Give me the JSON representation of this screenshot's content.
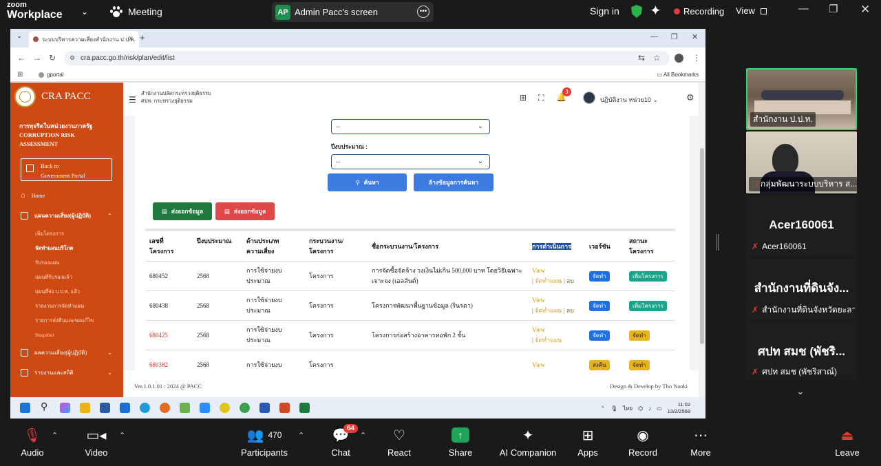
{
  "zoom": {
    "logo_line1": "zoom",
    "logo_line2": "Workplace",
    "meeting_label": "Meeting",
    "share_badge": "AP",
    "share_label": "Admin Pacc's screen",
    "signin": "Sign in",
    "recording": "Recording",
    "view": "View",
    "bottom": {
      "audio": "Audio",
      "video": "Video",
      "participants": "Participants",
      "participants_count": "470",
      "chat": "Chat",
      "chat_badge": "64",
      "react": "React",
      "share": "Share",
      "ai_companion": "AI Companion",
      "apps": "Apps",
      "record": "Record",
      "more": "More",
      "leave": "Leave"
    },
    "participants_panel": [
      {
        "type": "video",
        "name": "สำนักงาน ป.ป.ท.",
        "muted": false
      },
      {
        "type": "video",
        "name": "กลุ่มพัฒนาระบบบริหาร ส...",
        "muted": true
      },
      {
        "type": "text",
        "big": "Acer160061",
        "name": "Acer160061"
      },
      {
        "type": "text",
        "big": "สำนักงานที่ดินจัง...",
        "name": "สำนักงานที่ดินจังหวัดยะลา"
      },
      {
        "type": "text",
        "big": "ศปท สมช (พัชริ...",
        "name": "ศปท สมช (พัชริสาณ์)"
      }
    ]
  },
  "browser": {
    "tab_title": "ระบบบริหารความเสี่ยงสำนักงาน ป.ป.ท.",
    "url": "cra.pacc.go.th/risk/plan/edit/list",
    "bookmark": "gportal",
    "all_bookmarks": "All Bookmarks"
  },
  "sidebar": {
    "brand": "CRA PACC",
    "subtitle_1": "การทุจริตในหน่วยงานภาครัฐ",
    "subtitle_2": "CORRUPTION RISK",
    "subtitle_3": "ASSESSMENT",
    "back_1": "Back to",
    "back_2": "Government Portal",
    "home": "Home",
    "menu_plan": "แผนความเสี่ยง(ผู้ปฏิบัติ)",
    "sub_items": [
      "เพิ่มโครงการ",
      "จัดทำแผนบริโภค",
      "รับรองแผน",
      "แผนที่รับรองแล้ว",
      "แผนที่ส่ง ป.ป.ท. แล้ว",
      "รายงานการจัดทำแผน",
      "รายการส่งคืนและขอแก้ไข",
      "Snapshot"
    ],
    "menu_result": "ผลความเสี่ยง(ผู้ปฏิบัติ)",
    "menu_report": "รายงานและสถิติ"
  },
  "header": {
    "org_1": "สำนักงานปลัดกระทรวงยุติธรรม",
    "org_2": "ศปท. กระทรวงยุติธรรม",
    "notif_count": "3",
    "user": "ปฏิบัติงาน หน่วย10"
  },
  "filters": {
    "select1_value": "--",
    "fiscal_year_label": "ปีงบประมาณ :",
    "select2_value": "--",
    "search": "ค้นหา",
    "clear": "ล้างข้อมูลการค้นหา",
    "export_excel": "ส่งออกข้อมูล",
    "export_pdf": "ส่งออกข้อมูล"
  },
  "table": {
    "headers": [
      "เลขที่\nโครงการ",
      "ปีงบประมาณ",
      "ด้านประเภท\nความเสี่ยง",
      "กระบวนงาน/\nโครงการ",
      "ชื่อกระบวนงาน/โครงการ",
      "การดำเนินการ",
      "เวอร์ชัน",
      "สถานะ\nโครงการ"
    ],
    "rows": [
      {
        "id": "680452",
        "year": "2568",
        "risk": "การใช้จ่ายงบประมาณ",
        "type": "โครงการ",
        "name": "การจัดซื้อจัดจ้าง วงเงินไม่เกิน 500,000 บาท โดยวิธีเฉพาะเจาะจง (เอลสันต์)",
        "view": "View",
        "plan": "จัดทำแผน",
        "del": "ลบ",
        "version": "จัดทำ",
        "status": "เพิ่มโครงการ",
        "status_color": "teal",
        "ver_color": "blue"
      },
      {
        "id": "680438",
        "year": "2568",
        "risk": "การใช้จ่ายงบประมาณ",
        "type": "โครงการ",
        "name": "โครงการพัฒนาพื้นฐานข้อมูล (รินรดา)",
        "view": "View",
        "plan": "จัดทำแผน",
        "del": "ลบ",
        "version": "จัดทำ",
        "status": "เพิ่มโครงการ",
        "status_color": "teal",
        "ver_color": "blue"
      },
      {
        "id": "680425",
        "year": "2568",
        "risk": "การใช้จ่ายงบประมาณ",
        "type": "โครงการ",
        "name": "โครงการก่อสร้างอาคารหอพัก 2 ชั้น",
        "view": "View",
        "plan": "จัดทำแผน",
        "del": "",
        "version": "จัดทำ",
        "status": "จัดทำ",
        "status_color": "yellow",
        "ver_color": "blue"
      },
      {
        "id": "680382",
        "year": "2568",
        "risk": "การใช้จ่ายงบ",
        "type": "โครงการ",
        "name": "",
        "view": "View",
        "plan": "",
        "del": "",
        "version": "ส่งคืน",
        "status": "จัดทำ",
        "status_color": "yellow",
        "ver_color": "yellow"
      }
    ]
  },
  "footer": {
    "version": "Ver.1.0.1.01 : 2024 @ PACC",
    "credit": "Design & Develop by Tho Naoki"
  },
  "taskbar": {
    "time": "11:02",
    "date": "13/2/2568",
    "lang": "ไทย"
  }
}
